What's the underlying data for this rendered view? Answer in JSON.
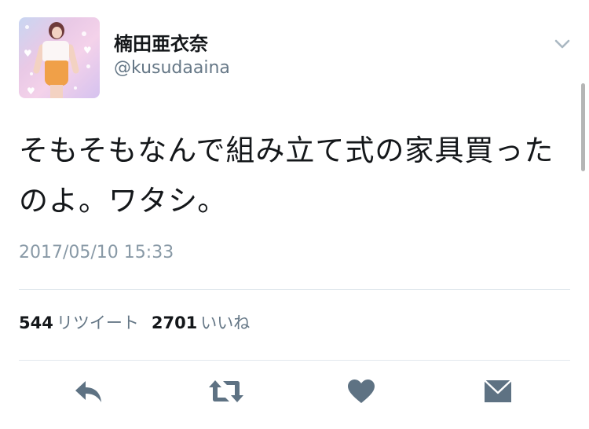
{
  "profile": {
    "display_name": "楠田亜衣奈",
    "handle": "@kusudaaina"
  },
  "tweet": {
    "text": "そもそもなんで組み立て式の家具買ったのよ。ワタシ。",
    "timestamp": "2017/05/10 15:33"
  },
  "stats": {
    "retweets_count": "544",
    "retweets_label": "リツイート",
    "likes_count": "2701",
    "likes_label": "いいね"
  },
  "icons": {
    "menu": "chevron-down-icon",
    "reply": "reply-icon",
    "retweet": "retweet-icon",
    "like": "heart-icon",
    "dm": "envelope-icon"
  },
  "colors": {
    "text": "#14171a",
    "secondary": "#657786",
    "timestamp": "#8899a6",
    "icon": "#5e7283",
    "divider": "#e1e8ed"
  }
}
